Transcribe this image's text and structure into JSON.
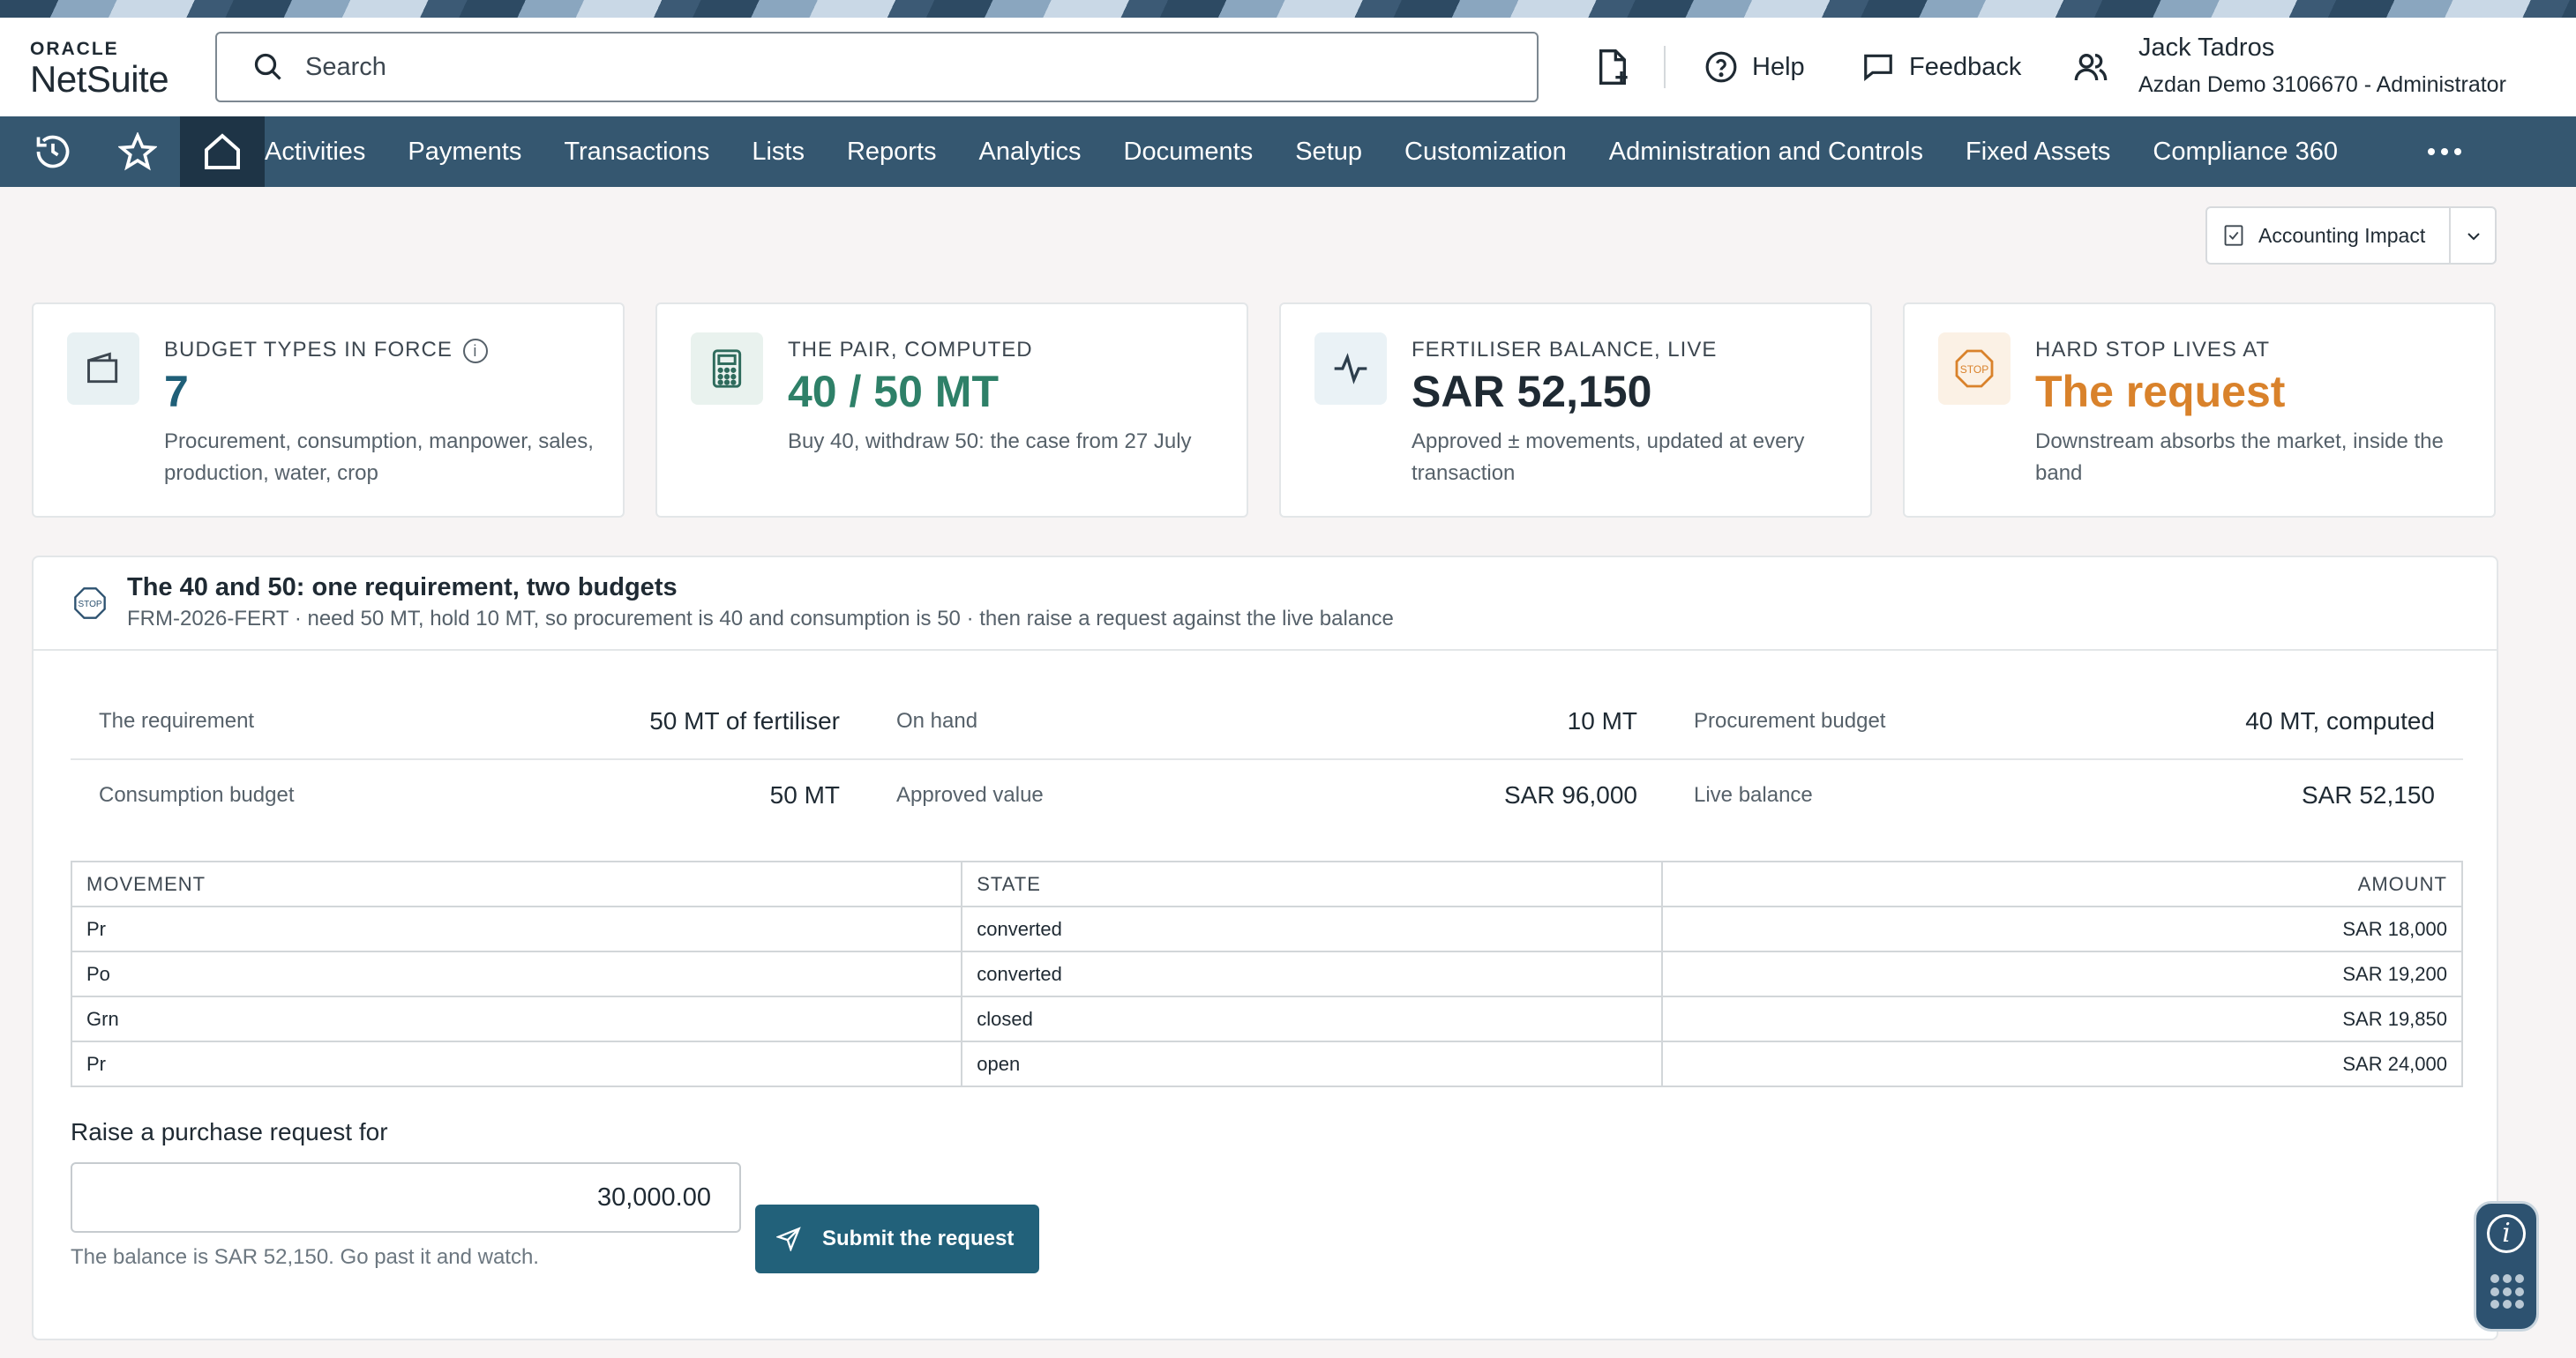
{
  "brand": {
    "oracle": "ORACLE",
    "netsuite": "NetSuite"
  },
  "search": {
    "placeholder": "Search"
  },
  "header": {
    "help": "Help",
    "feedback": "Feedback",
    "user_name": "Jack Tadros",
    "user_role": "Azdan Demo 3106670 - Administrator"
  },
  "nav": {
    "items": [
      "Activities",
      "Payments",
      "Transactions",
      "Lists",
      "Reports",
      "Analytics",
      "Documents",
      "Setup",
      "Customization",
      "Administration and Controls",
      "Fixed Assets",
      "Compliance 360"
    ]
  },
  "accounting_impact": {
    "label": "Accounting Impact"
  },
  "kpis": [
    {
      "label": "BUDGET TYPES IN FORCE",
      "value": "7",
      "desc": "Procurement, consumption, manpower, sales, production, water, crop",
      "icon": "wallet-icon",
      "value_color": "#1f5f78"
    },
    {
      "label": "THE PAIR, COMPUTED",
      "value": "40 / 50 MT",
      "desc": "Buy 40, withdraw 50: the case from 27 July",
      "icon": "calculator-icon",
      "value_color": "#2e8068"
    },
    {
      "label": "FERTILISER BALANCE, LIVE",
      "value": "SAR 52,150",
      "desc": "Approved ± movements, updated at every transaction",
      "icon": "activity-icon",
      "value_color": "#1f2a33"
    },
    {
      "label": "HARD STOP LIVES AT",
      "value": "The request",
      "desc": "Downstream absorbs the market, inside the band",
      "icon": "stop-icon",
      "value_color": "#d9822b"
    }
  ],
  "panel": {
    "title": "The 40 and 50: one requirement, two budgets",
    "subtitle": "FRM-2026-FERT · need 50 MT, hold 10 MT, so procurement is 40 and consumption is 50 · then raise a request against the live balance",
    "fields": [
      {
        "label": "The requirement",
        "value": "50 MT of fertiliser"
      },
      {
        "label": "On hand",
        "value": "10 MT"
      },
      {
        "label": "Procurement budget",
        "value": "40 MT, computed"
      },
      {
        "label": "Consumption budget",
        "value": "50 MT"
      },
      {
        "label": "Approved value",
        "value": "SAR 96,000"
      },
      {
        "label": "Live balance",
        "value": "SAR 52,150"
      }
    ],
    "table": {
      "headers": [
        "MOVEMENT",
        "STATE",
        "AMOUNT"
      ],
      "rows": [
        [
          "Pr",
          "converted",
          "SAR 18,000"
        ],
        [
          "Po",
          "converted",
          "SAR 19,200"
        ],
        [
          "Grn",
          "closed",
          "SAR 19,850"
        ],
        [
          "Pr",
          "open",
          "SAR 24,000"
        ]
      ]
    },
    "request": {
      "label": "Raise a purchase request for",
      "value": "30,000.00",
      "help": "The balance is SAR 52,150. Go past it and watch.",
      "submit": "Submit the request"
    }
  },
  "colors": {
    "nav": "#355770",
    "accent": "#22617a",
    "warning": "#d9822b"
  }
}
